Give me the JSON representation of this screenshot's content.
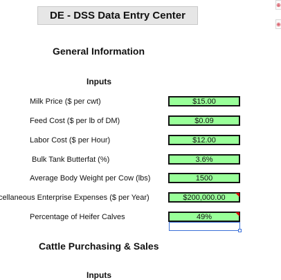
{
  "app": {
    "title": "DE - DSS Data Entry Center"
  },
  "general": {
    "section_title": "General Information",
    "inputs_heading": "Inputs",
    "rows": [
      {
        "label": "Milk Price ($ per cwt)",
        "value": "$15.00"
      },
      {
        "label": "Feed Cost ($ per lb of DM)",
        "value": "$0.09"
      },
      {
        "label": "Labor Cost ($ per Hour)",
        "value": "$12.00"
      },
      {
        "label": "Bulk Tank Butterfat (%)",
        "value": "3.6%"
      },
      {
        "label": "Average Body Weight per Cow (lbs)",
        "value": "1500"
      },
      {
        "label": "cellaneous Enterprise Expenses ($ per Year)",
        "value": "$200,000.00"
      },
      {
        "label": "Percentage of Heifer Calves",
        "value": "49%"
      }
    ]
  },
  "cattle": {
    "section_title": "Cattle Purchasing & Sales",
    "inputs_heading": "Inputs"
  },
  "colors": {
    "input_cell": "#99ff99",
    "comment_flag": "#d60000",
    "selection": "#3a6fd8"
  },
  "icons": [
    "comment-indicator-icon",
    "fill-handle-icon",
    "side-control-icon"
  ]
}
